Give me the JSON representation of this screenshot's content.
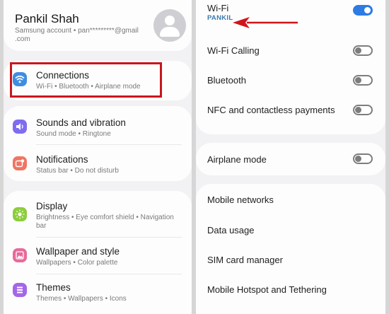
{
  "profile": {
    "name": "Pankil Shah",
    "account_line1": "Samsung account  •  pan*********@gmail",
    "account_line2": ".com"
  },
  "settings": {
    "connections": {
      "title": "Connections",
      "subtitle": "Wi-Fi  •  Bluetooth  •  Airplane mode",
      "icon": "wifi-icon",
      "icon_color": "#3f8de0"
    },
    "sounds": {
      "title": "Sounds and vibration",
      "subtitle": "Sound mode  •  Ringtone",
      "icon": "speaker-icon",
      "icon_color": "#7e6df0"
    },
    "notifications": {
      "title": "Notifications",
      "subtitle": "Status bar  •  Do not disturb",
      "icon": "notification-icon",
      "icon_color": "#f07563"
    },
    "display": {
      "title": "Display",
      "subtitle_line1": "Brightness  •  Eye comfort shield  •  Navigation",
      "subtitle_line2": "bar",
      "icon": "brightness-icon",
      "icon_color": "#8ccd3d"
    },
    "wallpaper": {
      "title": "Wallpaper and style",
      "subtitle": "Wallpapers  •  Color palette",
      "icon": "image-icon",
      "icon_color": "#e86a9a"
    },
    "themes": {
      "title": "Themes",
      "subtitle": "Themes  •  Wallpapers  •  Icons",
      "icon": "palette-icon",
      "icon_color": "#a466e8"
    }
  },
  "connections_menu": {
    "wifi": {
      "label": "Wi-Fi",
      "network": "PANKIL",
      "enabled": true
    },
    "wifi_calling": {
      "label": "Wi-Fi Calling",
      "enabled": false
    },
    "bluetooth": {
      "label": "Bluetooth",
      "enabled": false
    },
    "nfc": {
      "label": "NFC and contactless payments",
      "enabled": false
    },
    "airplane": {
      "label": "Airplane mode",
      "enabled": false
    },
    "mobile_networks": {
      "label": "Mobile networks"
    },
    "data_usage": {
      "label": "Data usage"
    },
    "sim_manager": {
      "label": "SIM card manager"
    },
    "hotspot": {
      "label": "Mobile Hotspot and Tethering"
    }
  },
  "colors": {
    "highlight": "#c8161d",
    "toggle_on": "#2d7be5",
    "arrow": "#d1141b"
  }
}
